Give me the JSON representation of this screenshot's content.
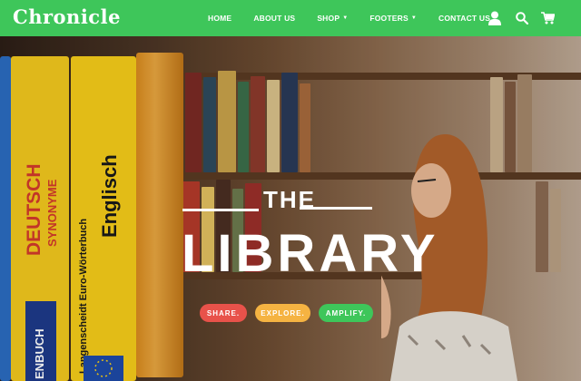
{
  "brand": {
    "logo": "Chronicle"
  },
  "nav": {
    "items": [
      {
        "label": "HOME",
        "dropdown": false
      },
      {
        "label": "ABOUT US",
        "dropdown": false
      },
      {
        "label": "SHOP",
        "dropdown": true
      },
      {
        "label": "FOOTERS",
        "dropdown": true
      },
      {
        "label": "CONTACT US",
        "dropdown": false
      }
    ],
    "icons": [
      "user-icon",
      "search-icon",
      "cart-icon"
    ]
  },
  "hero": {
    "title_small": "THE",
    "title_big": "LIBRARY",
    "buttons": [
      {
        "label": "SHARE.",
        "color": "#e8524a"
      },
      {
        "label": "EXPLORE.",
        "color": "#f5b342"
      },
      {
        "label": "AMPLIFY.",
        "color": "#3ec65a"
      }
    ],
    "books": [
      {
        "title": "DEUTSCH",
        "subtitle": "SYNONYME",
        "color": "#f2c81e"
      },
      {
        "title": "Englisch",
        "subtitle": "Langenscheidt Euro-Wörterbuch",
        "color": "#f6cc1a"
      },
      {
        "title": "ENBUCH"
      }
    ]
  },
  "colors": {
    "nav_bg": "#3ec65a"
  }
}
